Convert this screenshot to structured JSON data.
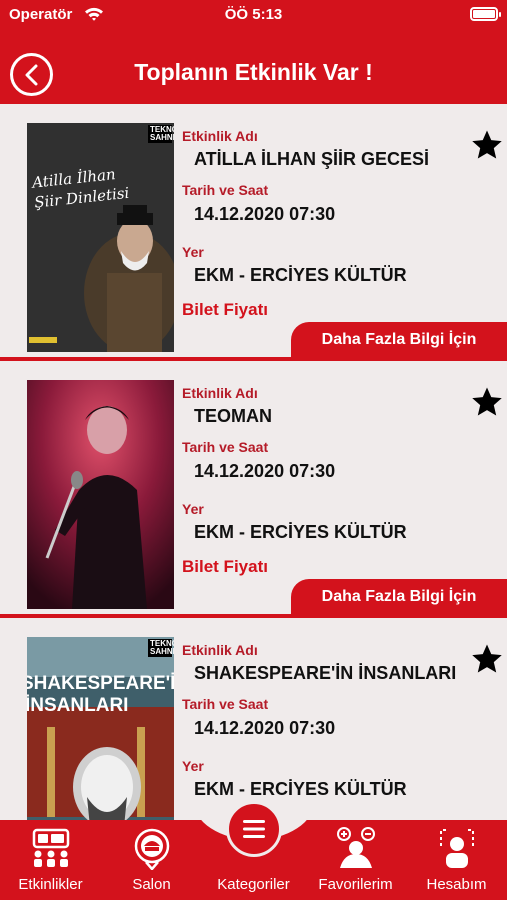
{
  "status_bar": {
    "carrier": "Operatör",
    "time": "ÖÖ 5:13"
  },
  "header": {
    "title": "Toplanın Etkinlik Var !"
  },
  "labels": {
    "event_name": "Etkinlik Adı",
    "date_time": "Tarih ve Saat",
    "place": "Yer",
    "price": "Bilet Fiyatı",
    "more_info": "Daha Fazla Bilgi İçin"
  },
  "events": [
    {
      "name": "ATİLLA İLHAN ŞİİR GECESİ",
      "datetime": "14.12.2020 07:30",
      "place": "EKM - ERCİYES KÜLTÜR",
      "poster_badge": "TEKNO SAHNE",
      "poster_text": "Atilla İlhan Şiir Dinletisi"
    },
    {
      "name": "TEOMAN",
      "datetime": "14.12.2020 07:30",
      "place": "EKM - ERCİYES KÜLTÜR"
    },
    {
      "name": "SHAKESPEARE'İN İNSANLARI",
      "datetime": "14.12.2020 07:30",
      "place": "EKM - ERCİYES KÜLTÜR",
      "poster_badge": "TEKNO SAHNE",
      "poster_text_1": "SHAKESPEARE'İN",
      "poster_text_2": "İNSANLARI"
    }
  ],
  "tabs": [
    {
      "label": "Etkinlikler",
      "icon": "events-icon"
    },
    {
      "label": "Salon",
      "icon": "salon-icon"
    },
    {
      "label": "Kategoriler",
      "icon": "menu-icon"
    },
    {
      "label": "Favorilerim",
      "icon": "favorites-icon"
    },
    {
      "label": "Hesabım",
      "icon": "account-icon"
    }
  ],
  "colors": {
    "primary": "#d3121c",
    "background": "#f0ebeb",
    "label": "#b51b28"
  }
}
